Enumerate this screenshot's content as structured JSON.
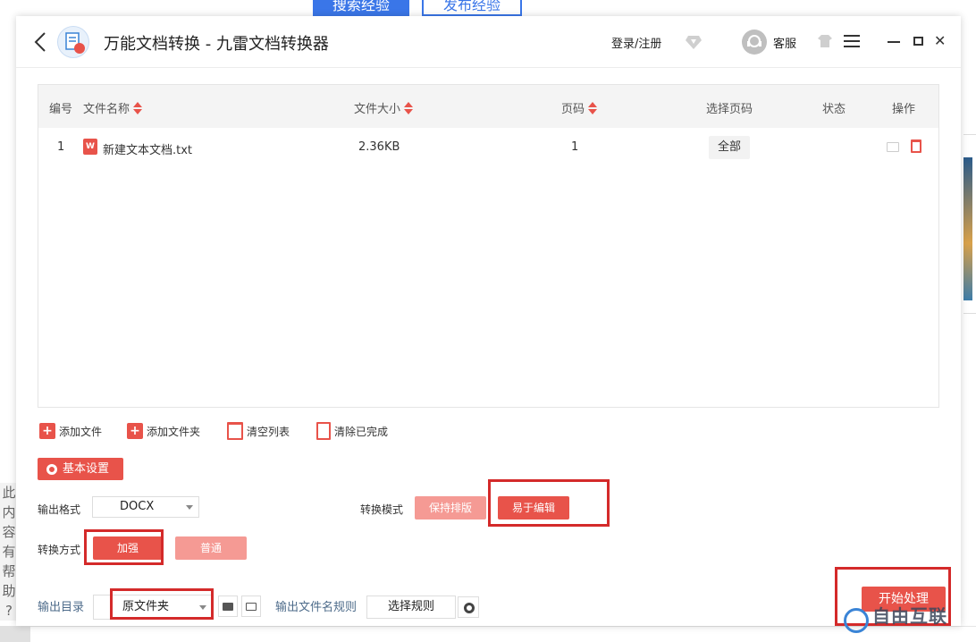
{
  "background": {
    "tabs": [
      "搜索经验",
      "发布经验"
    ],
    "side_text": [
      "此",
      "内",
      "容",
      "有",
      "帮",
      "助",
      "?"
    ]
  },
  "titlebar": {
    "app_title": "万能文档转换 - 九雷文档转换器",
    "login_label": "登录/注册",
    "service_label": "客服"
  },
  "table": {
    "headers": {
      "index": "编号",
      "file_name": "文件名称",
      "file_size": "文件大小",
      "pages": "页码",
      "select_pages": "选择页码",
      "status": "状态",
      "actions": "操作"
    },
    "rows": [
      {
        "index": "1",
        "file_name": "新建文本文档.txt",
        "file_size": "2.36KB",
        "pages": "1",
        "select_pages": "全部",
        "status": ""
      }
    ]
  },
  "toolbar": {
    "add_file": "添加文件",
    "add_folder": "添加文件夹",
    "clear_list": "清空列表",
    "clear_done": "清除已完成"
  },
  "settings": {
    "title": "基本设置",
    "output_format_label": "输出格式",
    "output_format_value": "DOCX",
    "convert_mode_label": "转换模式",
    "mode_keep_layout": "保持排版",
    "mode_easy_edit": "易于编辑",
    "convert_method_label": "转换方式",
    "method_enhanced": "加强",
    "method_normal": "普通",
    "output_dir_label": "输出目录",
    "output_dir_value": "原文件夹",
    "filename_rule_label": "输出文件名规则",
    "select_rule": "选择规则",
    "start_button": "开始处理"
  },
  "watermark": "自由互联",
  "colors": {
    "accent": "#e8534a",
    "accent_light": "#f59a94",
    "highlight": "#d42a2a",
    "bg_tab": "#3a76e8"
  }
}
